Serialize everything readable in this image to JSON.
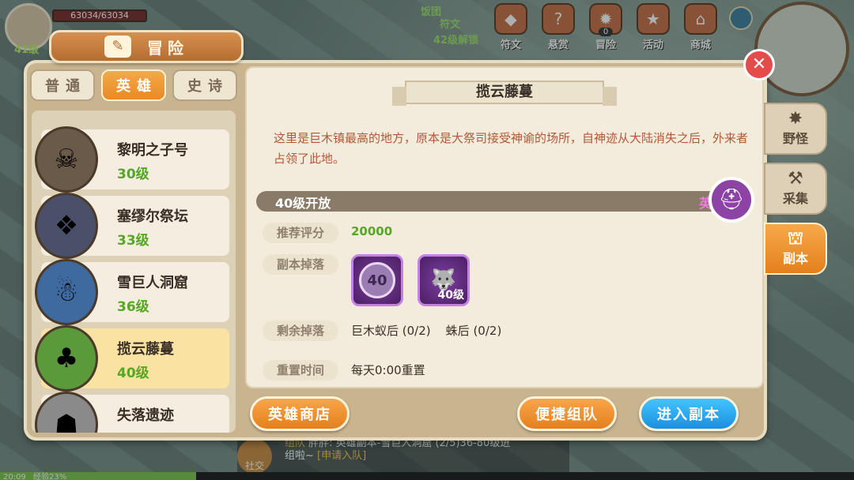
{
  "hud": {
    "hp": "63034/63034",
    "player_level": "41级",
    "quest_fragment": "饭团",
    "rune_title": "符文",
    "rune_unlock": "42级解锁",
    "icons": [
      {
        "icon": "rune-icon",
        "label": "符文",
        "glyph": "◆"
      },
      {
        "icon": "bounty-icon",
        "label": "悬赏",
        "glyph": "?"
      },
      {
        "icon": "demon-icon",
        "label": "冒险",
        "glyph": "✹",
        "count": "0"
      },
      {
        "icon": "event-icon",
        "label": "活动",
        "glyph": "★"
      },
      {
        "icon": "shop-icon",
        "label": "商城",
        "glyph": "⌂"
      }
    ]
  },
  "panel": {
    "title": "冒险",
    "tabs": [
      "普通",
      "英雄",
      "史诗"
    ],
    "active_tab": 1
  },
  "dungeons": [
    {
      "name": "黎明之子号",
      "level": "30级",
      "color": "#6a5a4a",
      "glyph": "☠"
    },
    {
      "name": "塞缪尔祭坛",
      "level": "33级",
      "color": "#4a4f6a",
      "glyph": "❖"
    },
    {
      "name": "雪巨人洞窟",
      "level": "36级",
      "color": "#3f6aa0",
      "glyph": "☃"
    },
    {
      "name": "揽云藤蔓",
      "level": "40级",
      "color": "#5a9a3a",
      "glyph": "♣",
      "selected": true
    },
    {
      "name": "失落遗迹",
      "level": "",
      "color": "#8a8a8a",
      "glyph": "☗"
    }
  ],
  "detail": {
    "name": "揽云藤蔓",
    "description": "这里是巨木镇最高的地方，原本是大祭司接受神谕的场所，自神迹从大陆消失之后，外来者占领了此地。",
    "open_level": "40级开放",
    "difficulty": "英雄",
    "recommend_label": "推荐评分",
    "recommend_value": "20000",
    "drops_label": "副本掉落",
    "drops": [
      {
        "icon": "coin-icon",
        "text": "40"
      },
      {
        "icon": "wolf-icon",
        "text": "40级"
      }
    ],
    "remaining_label": "剩余掉落",
    "remaining_value": "巨木蚁后 (0/2)    蛛后 (0/2)",
    "reset_label": "重置时间",
    "reset_value": "每天0:00重置"
  },
  "buttons": {
    "hero_shop": "英雄商店",
    "quick_team": "便捷组队",
    "enter": "进入副本"
  },
  "side_tabs": [
    {
      "label": "野怪",
      "glyph": "✸"
    },
    {
      "label": "采集",
      "glyph": "⚒"
    },
    {
      "label": "副本",
      "glyph": "⛫",
      "active": true
    }
  ],
  "chat": {
    "social": "社交",
    "line1_tag": "组队",
    "line1": "胖胖: 英雄副本-雪巨人洞窟 (2/5)36-80级进",
    "line2": "组啦~",
    "line2_tag": "[申请入队]"
  },
  "status": {
    "time": "20:09",
    "exp": "经验23%",
    "exp_percent": 23
  }
}
